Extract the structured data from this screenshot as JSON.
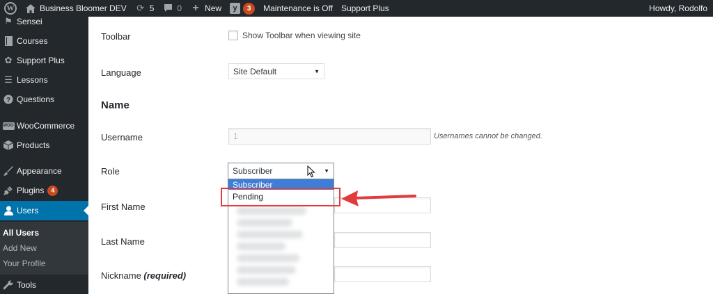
{
  "adminbar": {
    "site_name": "Business Bloomer DEV",
    "updates_count": "5",
    "comments_count": "0",
    "new_label": "New",
    "seo_count": "3",
    "maintenance": "Maintenance is Off",
    "support": "Support Plus",
    "greeting": "Howdy, Rodolfo"
  },
  "sidebar": {
    "items": [
      {
        "label": "Sensei",
        "icon": "flag-icon"
      },
      {
        "label": "Courses",
        "icon": "book-icon"
      },
      {
        "label": "Support Plus",
        "icon": "gear-icon"
      },
      {
        "label": "Lessons",
        "icon": "list-icon"
      },
      {
        "label": "Questions",
        "icon": "question-icon"
      },
      {
        "label": "WooCommerce",
        "icon": "woo-icon"
      },
      {
        "label": "Products",
        "icon": "box-icon"
      },
      {
        "label": "Appearance",
        "icon": "brush-icon"
      },
      {
        "label": "Plugins",
        "icon": "plug-icon",
        "badge": "4"
      },
      {
        "label": "Users",
        "icon": "user-icon"
      },
      {
        "label": "Tools",
        "icon": "wrench-icon"
      }
    ],
    "users_submenu": [
      "All Users",
      "Add New",
      "Your Profile"
    ]
  },
  "form": {
    "toolbar_label": "Toolbar",
    "toolbar_checkbox": "Show Toolbar when viewing site",
    "language_label": "Language",
    "language_value": "Site Default",
    "name_section": "Name",
    "username_label": "Username",
    "username_value": "1",
    "username_note": "Usernames cannot be changed.",
    "role_label": "Role",
    "role_value": "Subscriber",
    "role_options": [
      "Subscriber",
      "Pending"
    ],
    "first_name_label": "First Name",
    "last_name_label": "Last Name",
    "nickname_label": "Nickname",
    "nickname_required": "(required)"
  },
  "colors": {
    "admin_dark": "#23282d",
    "accent": "#0073aa",
    "badge": "#ca4a1f",
    "highlight": "#3d7fd8",
    "annotation": "#e23b3b"
  }
}
